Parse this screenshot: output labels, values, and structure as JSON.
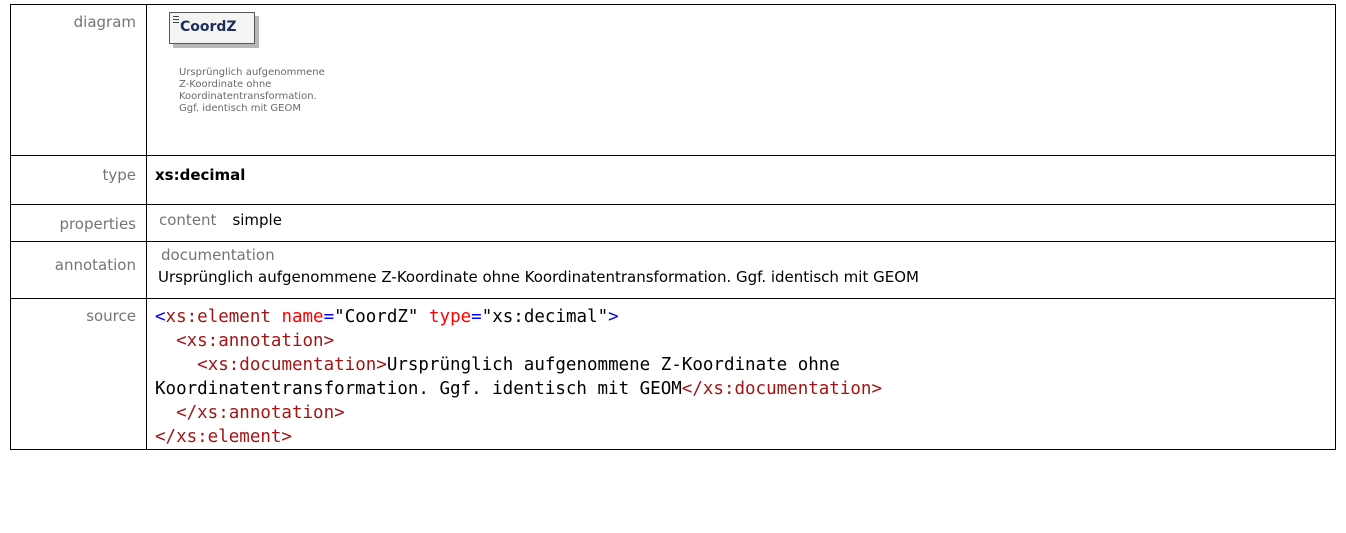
{
  "labels": {
    "diagram": "diagram",
    "type": "type",
    "properties": "properties",
    "annotation": "annotation",
    "source": "source"
  },
  "diagram": {
    "element_name": "CoordZ",
    "doc_lines": [
      "Ursprünglich aufgenommene",
      "Z-Koordinate ohne",
      "Koordinatentransformation.",
      "Ggf. identisch mit GEOM"
    ]
  },
  "type_value": "xs:decimal",
  "properties": {
    "key": "content",
    "value": "simple"
  },
  "annotation": {
    "key": "documentation",
    "text": "Ursprünglich aufgenommene Z-Koordinate ohne Koordinatentransformation. Ggf. identisch mit GEOM"
  },
  "source": {
    "open_lt": "<",
    "open_name": "xs:element",
    "attr1_name": "name",
    "attr1_value": "\"CoordZ\"",
    "attr2_name": "type",
    "attr2_value": "\"xs:decimal\"",
    "gt": ">",
    "annotation_open": "<xs:annotation>",
    "doc_open": "<xs:documentation>",
    "doc_text_1": "Ursprünglich aufgenommene Z-Koordinate ohne",
    "doc_text_2": "Koordinatentransformation. Ggf. identisch mit GEOM",
    "doc_close": "</xs:documentation>",
    "annotation_close": "</xs:annotation>",
    "element_close": "</xs:element>"
  }
}
